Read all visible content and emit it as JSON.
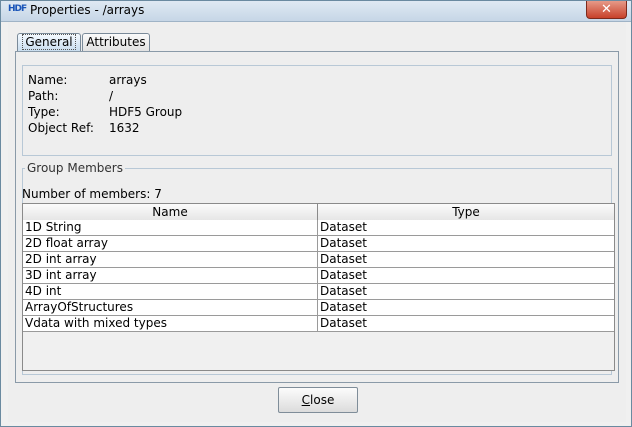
{
  "window": {
    "title": "Properties - /arrays",
    "app_icon": "HDF",
    "close_glyph": "✕"
  },
  "tabs": [
    {
      "label": "General",
      "selected": true
    },
    {
      "label": "Attributes",
      "selected": false
    }
  ],
  "info": [
    {
      "label": "Name:",
      "value": "arrays"
    },
    {
      "label": "Path:",
      "value": "/"
    },
    {
      "label": "Type:",
      "value": "HDF5 Group"
    },
    {
      "label": "Object Ref:",
      "value": "1632"
    }
  ],
  "members": {
    "legend": "Group Members",
    "count_text": "Number of members: 7",
    "columns": {
      "name": "Name",
      "type": "Type"
    },
    "rows": [
      {
        "name": "1D String",
        "type": "Dataset"
      },
      {
        "name": "2D float array",
        "type": "Dataset"
      },
      {
        "name": "2D int array",
        "type": "Dataset"
      },
      {
        "name": "3D int array",
        "type": "Dataset"
      },
      {
        "name": "4D int",
        "type": "Dataset"
      },
      {
        "name": "ArrayOfStructures",
        "type": "Dataset"
      },
      {
        "name": "Vdata with mixed types",
        "type": "Dataset"
      }
    ]
  },
  "buttons": {
    "close_mnemonic": "C",
    "close_rest": "lose"
  }
}
